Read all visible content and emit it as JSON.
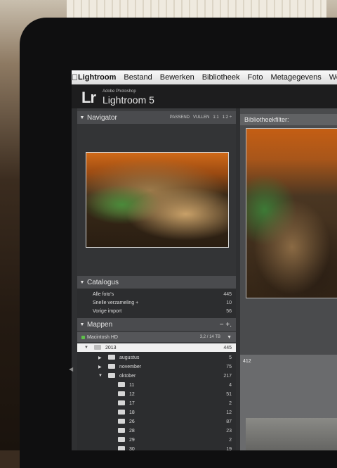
{
  "menu": {
    "app": "Lightroom",
    "items": [
      "Bestand",
      "Bewerken",
      "Bibliotheek",
      "Foto",
      "Metagegevens",
      "Wee"
    ]
  },
  "identity": {
    "logo": "Lr",
    "small": "Adobe Photoshop",
    "name": "Lightroom 5"
  },
  "navigator": {
    "title": "Navigator",
    "zoom": [
      "PASSEND",
      "VULLEN",
      "1:1",
      "1:2 ÷"
    ]
  },
  "catalogus": {
    "title": "Catalogus",
    "items": [
      {
        "label": "Alle foto's",
        "count": "445"
      },
      {
        "label": "Snelle verzameling  +",
        "count": "10"
      },
      {
        "label": "Vorige import",
        "count": "56"
      }
    ]
  },
  "mappen": {
    "title": "Mappen",
    "actions": "− +.",
    "disk": {
      "label": "Macintosh HD",
      "info": "3,2 / 14 TB"
    },
    "year": {
      "label": "2013",
      "count": "445"
    },
    "months": [
      {
        "label": "augustus",
        "count": "5"
      },
      {
        "label": "november",
        "count": "75"
      },
      {
        "label": "oktober",
        "count": "217"
      }
    ],
    "days": [
      {
        "label": "11",
        "count": "4"
      },
      {
        "label": "12",
        "count": "51"
      },
      {
        "label": "17",
        "count": "2"
      },
      {
        "label": "18",
        "count": "12"
      },
      {
        "label": "26",
        "count": "87"
      },
      {
        "label": "28",
        "count": "23"
      },
      {
        "label": "29",
        "count": "2"
      },
      {
        "label": "30",
        "count": "19"
      }
    ]
  },
  "content": {
    "filter_title": "Bibliotheekfilter:",
    "cell_number": "412"
  }
}
